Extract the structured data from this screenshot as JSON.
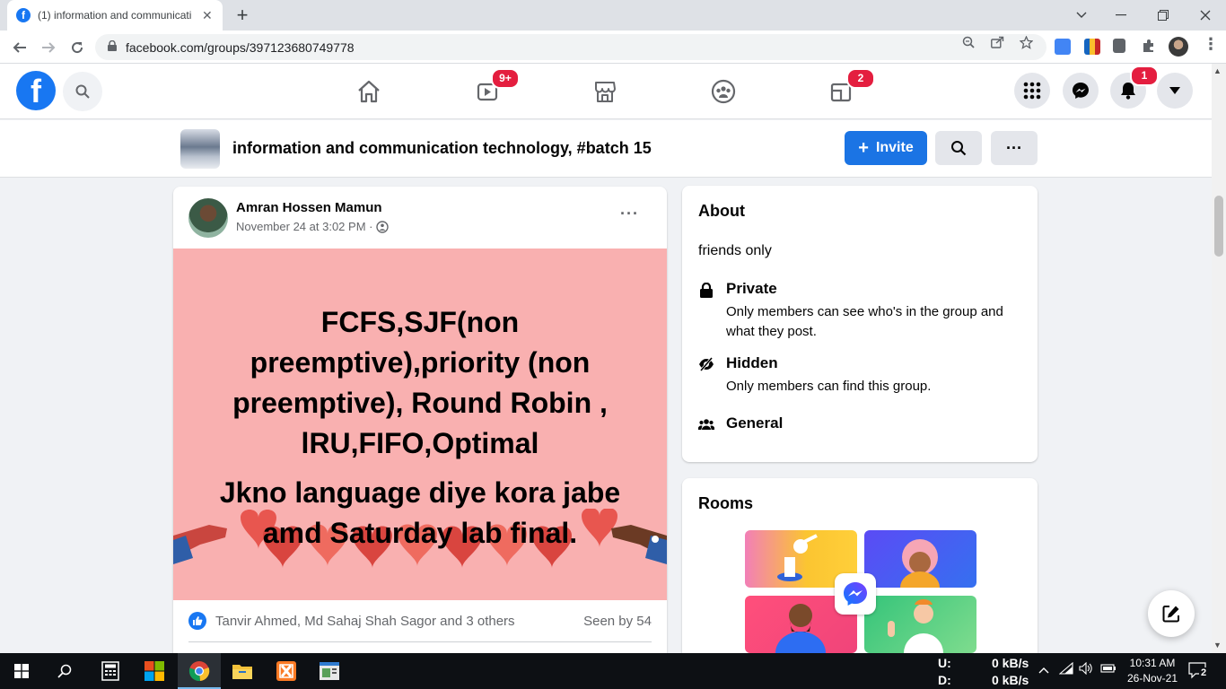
{
  "browser": {
    "tab_title": "(1) information and communicati",
    "tab_favicon": "f",
    "new_tab": "+",
    "url": "facebook.com/groups/397123680749778"
  },
  "header": {
    "logo_letter": "f",
    "watch_badge": "9+",
    "groups_badge": "2",
    "notifications_badge": "1"
  },
  "group": {
    "name": "information and communication technology, #batch 15",
    "invite_label": "Invite",
    "invite_plus": "+",
    "more_label": "···"
  },
  "post": {
    "author": "Amran Hossen Mamun",
    "timestamp": "November 24 at 3:02 PM ·",
    "more_label": "···",
    "image_text_1": "FCFS,SJF(non preemptive),priority (non preemptive), Round Robin , lRU,FIFO,Optimal",
    "image_text_2": "Jkno language diye kora jabe amd Saturday lab final.",
    "reactions": "Tanvir Ahmed, Md Sahaj Shah Sagor and 3 others",
    "seen": "Seen by 54"
  },
  "about": {
    "title": "About",
    "description": "friends only",
    "items": [
      {
        "icon": "lock-icon",
        "title": "Private",
        "subtitle": "Only members can see who's in the group and what they post."
      },
      {
        "icon": "eye-slash-icon",
        "title": "Hidden",
        "subtitle": "Only members can find this group."
      },
      {
        "icon": "people-icon",
        "title": "General",
        "subtitle": ""
      }
    ]
  },
  "rooms": {
    "title": "Rooms"
  },
  "taskbar": {
    "upload_label": "U:",
    "download_label": "D:",
    "upload_speed": "0 kB/s",
    "download_speed": "0 kB/s",
    "time": "10:31 AM",
    "date": "26-Nov-21",
    "notification_count": "2"
  },
  "colors": {
    "facebook_blue": "#1877f2",
    "invite_blue": "#1b74e4",
    "badge_red": "#e41e3f",
    "post_image_bg": "#f9b0b0"
  }
}
